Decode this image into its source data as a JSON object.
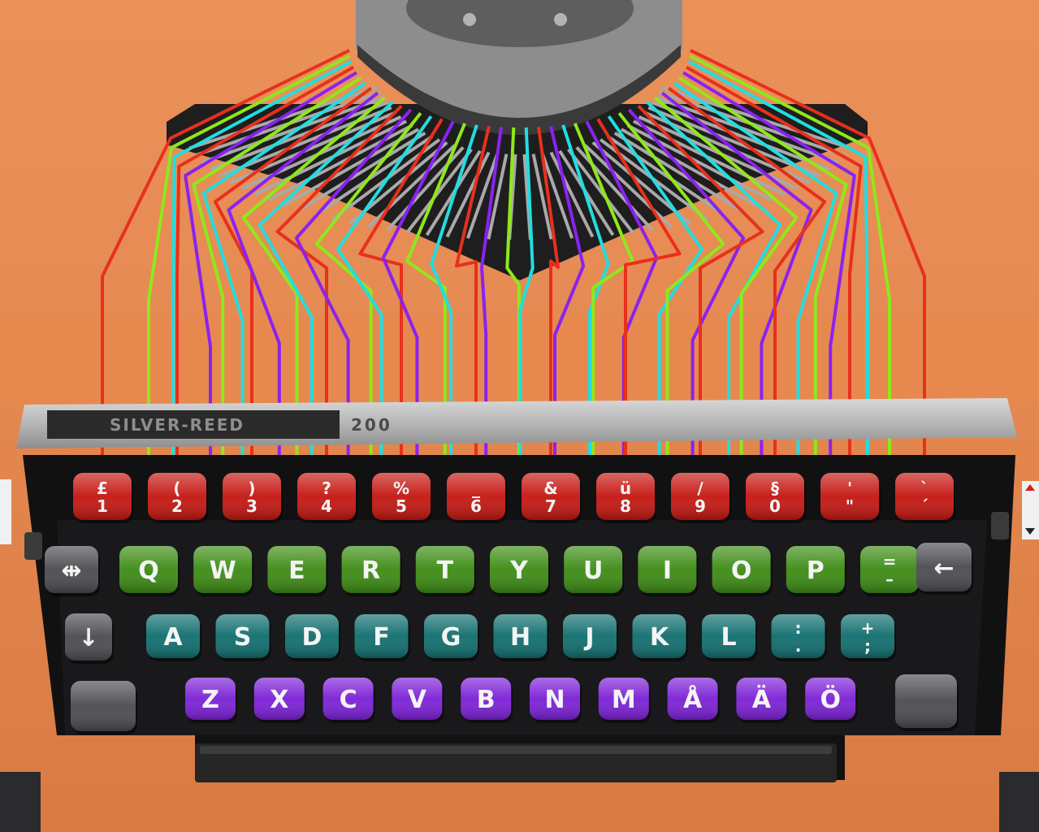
{
  "brand": {
    "nameplate": "SILVER-REED",
    "model": "200"
  },
  "palette": {
    "body": "#e58a52",
    "body_light": "#ee9a62",
    "row_numbers": "#c4150f",
    "row_top_letters": "#3b8a12",
    "row_home": "#0f6d6d",
    "row_bottom": "#7b1fd6",
    "wire_red": "#e8301c",
    "wire_green": "#8fe81a",
    "wire_cyan": "#22dde0",
    "wire_purple": "#8a22f0",
    "grey_key": "#4a4b4f"
  },
  "keyboard": {
    "rows": [
      {
        "name": "numbers",
        "keys": [
          {
            "top": "£",
            "bottom": "1"
          },
          {
            "top": "(",
            "bottom": "2"
          },
          {
            "top": ")",
            "bottom": "3"
          },
          {
            "top": "?",
            "bottom": "4"
          },
          {
            "top": "%",
            "bottom": "5"
          },
          {
            "top": "_",
            "bottom": "6"
          },
          {
            "top": "&",
            "bottom": "7"
          },
          {
            "top": "ü",
            "bottom": "8"
          },
          {
            "top": "/",
            "bottom": "9"
          },
          {
            "top": "§",
            "bottom": "0"
          },
          {
            "top": "'",
            "bottom": "\""
          },
          {
            "top": "`",
            "bottom": "´"
          }
        ]
      },
      {
        "name": "top-letters",
        "keys": [
          {
            "label": "Q"
          },
          {
            "label": "W"
          },
          {
            "label": "E"
          },
          {
            "label": "R"
          },
          {
            "label": "T"
          },
          {
            "label": "Y"
          },
          {
            "label": "U"
          },
          {
            "label": "I"
          },
          {
            "label": "O"
          },
          {
            "label": "P"
          },
          {
            "top": "=",
            "bottom": "–"
          }
        ]
      },
      {
        "name": "home",
        "keys": [
          {
            "label": "A"
          },
          {
            "label": "S"
          },
          {
            "label": "D"
          },
          {
            "label": "F"
          },
          {
            "label": "G"
          },
          {
            "label": "H"
          },
          {
            "label": "J"
          },
          {
            "label": "K"
          },
          {
            "label": "L"
          },
          {
            "top": ":",
            "bottom": "."
          },
          {
            "top": "+",
            "bottom": ";"
          }
        ]
      },
      {
        "name": "bottom",
        "keys": [
          {
            "label": "Z"
          },
          {
            "label": "X"
          },
          {
            "label": "C"
          },
          {
            "label": "V"
          },
          {
            "label": "B"
          },
          {
            "label": "N"
          },
          {
            "label": "M"
          },
          {
            "label": "Å"
          },
          {
            "label": "Ä"
          },
          {
            "label": "Ö"
          }
        ]
      }
    ],
    "function_keys": [
      {
        "name": "margin-release",
        "glyph": "⇹"
      },
      {
        "name": "shift-lock",
        "glyph": "↓"
      },
      {
        "name": "shift-left",
        "glyph": ""
      },
      {
        "name": "backspace",
        "glyph": "←"
      },
      {
        "name": "shift-right",
        "glyph": ""
      }
    ]
  }
}
